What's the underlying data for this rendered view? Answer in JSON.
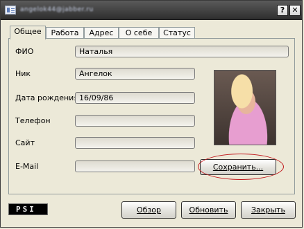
{
  "window": {
    "title": "angelok44@jabber.ru",
    "help_label": "?",
    "close_label": "✕",
    "icon": "contact-card-icon"
  },
  "tabs": [
    {
      "label": "Общее",
      "active": true
    },
    {
      "label": "Работа"
    },
    {
      "label": "Адрес"
    },
    {
      "label": "О себе"
    },
    {
      "label": "Статус"
    }
  ],
  "form": {
    "name": {
      "label": "ФИО",
      "value": "Наталья"
    },
    "nick": {
      "label": "Ник",
      "value": "Ангелок"
    },
    "birthdate": {
      "label": "Дата рождения",
      "value": "16/09/86"
    },
    "phone": {
      "label": "Телефон",
      "value": ""
    },
    "site": {
      "label": "Сайт",
      "value": ""
    },
    "email": {
      "label": "E-Mail",
      "value": ""
    }
  },
  "actions": {
    "save": "Сохранить...",
    "browse": "Обзор",
    "refresh": "Обновить",
    "close": "Закрыть"
  },
  "logo": {
    "text": "PSI"
  },
  "colors": {
    "highlight": "#c0161a",
    "titlebar": "#3a3a3a",
    "window_bg": "#ece9d8"
  }
}
